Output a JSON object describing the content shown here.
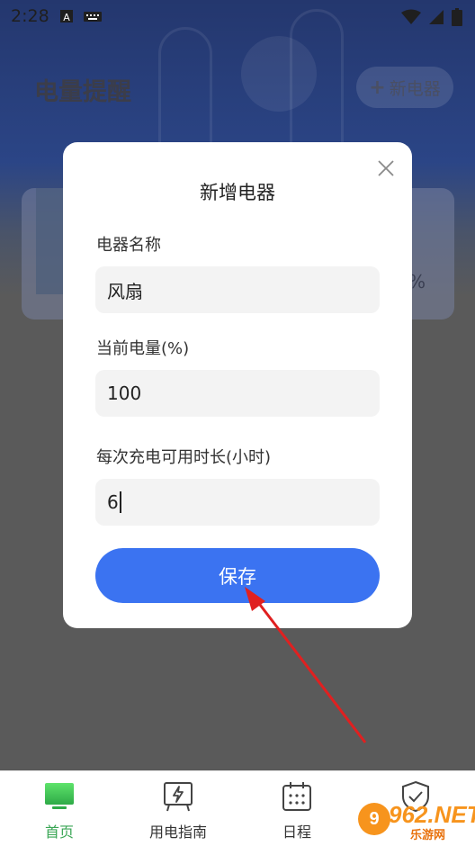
{
  "status_bar": {
    "time": "2:28"
  },
  "background": {
    "title": "电量提醒",
    "add_button_label": "新电器",
    "card_percent": "%"
  },
  "dialog": {
    "title": "新增电器",
    "fields": [
      {
        "label": "电器名称",
        "value": "风扇"
      },
      {
        "label": "当前电量(%)",
        "value": "100"
      },
      {
        "label": "每次充电可用时长(小时)",
        "value": "6"
      }
    ],
    "save_label": "保存"
  },
  "bottom_nav": {
    "items": [
      {
        "label": "首页",
        "icon": "monitor-icon",
        "active": true
      },
      {
        "label": "用电指南",
        "icon": "power-board-icon",
        "active": false
      },
      {
        "label": "日程",
        "icon": "calendar-icon",
        "active": false
      },
      {
        "label": "",
        "icon": "shield-check-icon",
        "active": false
      }
    ]
  },
  "watermark": {
    "brand": "962.NET",
    "sub": "乐游网"
  },
  "colors": {
    "accent": "#3b73f1",
    "nav_active": "#3aa655",
    "arrow": "#e02020"
  }
}
